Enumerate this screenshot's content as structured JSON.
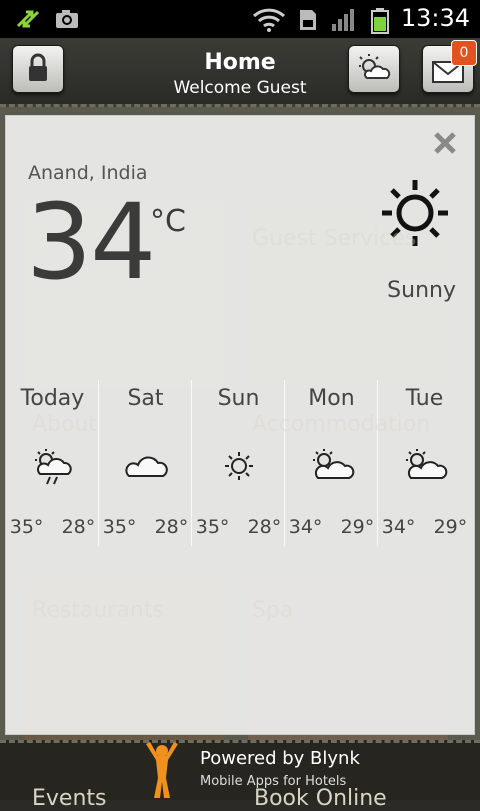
{
  "status_bar": {
    "time": "13:34"
  },
  "header": {
    "title": "Home",
    "subtitle": "Welcome Guest",
    "mail_badge": "0"
  },
  "background_tiles": [
    "Guest Services",
    "About",
    "Accommodation",
    "Restaurants",
    "Spa",
    "Events",
    "Book Online"
  ],
  "weather": {
    "location": "Anand, India",
    "temperature": "34",
    "unit": "°C",
    "condition": "Sunny",
    "forecast": [
      {
        "day": "Today",
        "icon": "thunderstorm-partly-cloudy-icon",
        "high": "35°",
        "low": "28°"
      },
      {
        "day": "Sat",
        "icon": "cloud-icon",
        "high": "35°",
        "low": "28°"
      },
      {
        "day": "Sun",
        "icon": "sun-icon",
        "high": "35°",
        "low": "28°"
      },
      {
        "day": "Mon",
        "icon": "partly-cloudy-icon",
        "high": "34°",
        "low": "29°"
      },
      {
        "day": "Tue",
        "icon": "partly-cloudy-icon",
        "high": "34°",
        "low": "29°"
      }
    ]
  },
  "footer": {
    "powered": "Powered by Blynk",
    "tagline": "Mobile Apps for Hotels"
  }
}
